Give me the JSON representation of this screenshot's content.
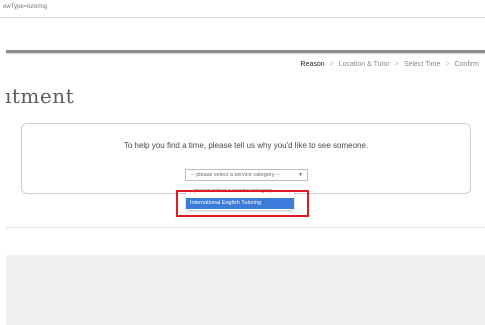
{
  "browser": {
    "url_fragment": "ewType=tutoring"
  },
  "steps": {
    "items": [
      "Reason",
      "Location & Tutor",
      "Select Time",
      "Confirm"
    ],
    "separator": ">",
    "active_index": 0
  },
  "page": {
    "title_fragment": "ıtment"
  },
  "panel": {
    "prompt": "To help you find a time, please tell us why you'd like to see someone."
  },
  "service_select": {
    "selected_value": "-- please select a service category --",
    "options": [
      "please select a service category",
      "International English Tutoring"
    ],
    "highlighted_option_index": 1
  },
  "colors": {
    "highlight_border": "#e21b23",
    "option_highlight": "#3c7bd8"
  }
}
